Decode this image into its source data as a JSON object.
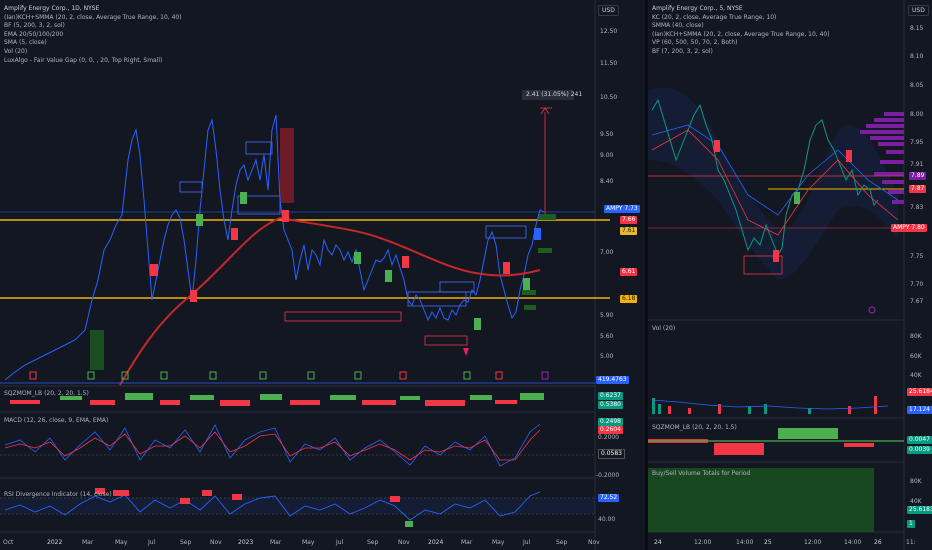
{
  "left_chart": {
    "legend": [
      "Amplify Energy Corp., 1D, NYSE",
      "(Ian)KCH+SMMA (20, 2, close, Average True Range, 10, 40)",
      "BF (5, 200, 3, 2, sol)",
      "EMA 20/50/100/200",
      "SMA (5, close)",
      "Vol (20)",
      "LuxAlgo - Fair Value Gap (0, 0, , 20, Top Right, Small)"
    ],
    "currency": "USD",
    "price_ticks": [
      "12.50",
      "11.50",
      "10.50",
      "9.50",
      "9.00",
      "8.40",
      "7.60",
      "7.00",
      "6.50",
      "6.00",
      "5.90",
      "5.60",
      "5.00"
    ],
    "price_tags": [
      {
        "text": "AMPY  7.73",
        "color": "#2962ff"
      },
      {
        "text": "7.66",
        "color": "#f23645"
      },
      {
        "text": "7.61",
        "color": "#e8b92a"
      },
      {
        "text": "6.61",
        "color": "#f23645"
      },
      {
        "text": "6.18",
        "color": "#f5b301"
      }
    ],
    "measure_label": "2.41 (31.05%) 241",
    "x_ticks": [
      "Oct",
      "2022",
      "Mar",
      "May",
      "Jul",
      "Sep",
      "Nov",
      "2023",
      "Mar",
      "May",
      "Jul",
      "Sep",
      "Nov",
      "2024",
      "Mar",
      "May",
      "Jul",
      "Sep",
      "Nov"
    ],
    "sqzmom_title": "SQZMOM_LB (20, 2, 20, 1.5)",
    "sqzmom_tags": [
      {
        "text": "0.6237",
        "color": "#089981"
      },
      {
        "text": "0.5380",
        "color": "#089981"
      }
    ],
    "macd_title": "MACD (12, 26, close, 9, EMA, EMA)",
    "macd_tags": [
      {
        "text": "0.2498",
        "color": "#089981"
      },
      {
        "text": "0.2604",
        "color": "#f23645"
      },
      {
        "text": "0.0583",
        "color": "#131722"
      }
    ],
    "macd_ticks": [
      "0.2000",
      "-0.2000"
    ],
    "rsi_title": "RSI Divergence Indicator (14, close)",
    "rsi_tags": [
      {
        "text": "72.52",
        "color": "#2962ff"
      }
    ],
    "rsi_ticks": [
      "60.00",
      "40.00"
    ],
    "vol_tag": {
      "text": "419.4763",
      "color": "#2962ff"
    }
  },
  "right_chart": {
    "legend": [
      "Amplify Energy Corp., 5, NYSE",
      "KC (20, 2, close, Average True Range, 10)",
      "SMMA (40, close)",
      "(Ian)KCH+SMMA (20, 2, close, Average True Range, 10, 40)",
      "VP (60, 500, 50, 70, 2, Both)",
      "BF (7, 200, 3, 2, sol)"
    ],
    "currency": "USD",
    "price_ticks": [
      "8.15",
      "8.10",
      "8.05",
      "8.00",
      "7.95",
      "7.91",
      "7.85",
      "7.83",
      "7.75",
      "7.70",
      "7.67"
    ],
    "price_tags": [
      {
        "text": "7.89",
        "color": "#7b1fa2"
      },
      {
        "text": "7.87",
        "color": "#f23645"
      },
      {
        "text": "AMPY  7.80",
        "color": "#f23645"
      }
    ],
    "vol_title": "Vol (20)",
    "vol_ticks": [
      "80K",
      "60K",
      "40K"
    ],
    "vol_tags": [
      {
        "text": "25.6184",
        "color": "#f23645"
      },
      {
        "text": "17.124",
        "color": "#2962ff"
      }
    ],
    "sqzmom_title": "SQZMOM_LB (20, 2, 20, 1.5)",
    "sqzmom_tags": [
      {
        "text": "0.0047",
        "color": "#089981"
      },
      {
        "text": "0.0039",
        "color": "#089981"
      }
    ],
    "bsv_title": "Buy/Sell Volume Totals for Period",
    "bsv_ticks": [
      "80K",
      "40K"
    ],
    "bsv_tags": [
      {
        "text": "25.6183",
        "color": "#089981"
      },
      {
        "text": "1",
        "color": "#089981"
      }
    ],
    "x_ticks": [
      "24",
      "12:00",
      "14:00",
      "25",
      "12:00",
      "14:00",
      "26",
      "11:"
    ]
  }
}
